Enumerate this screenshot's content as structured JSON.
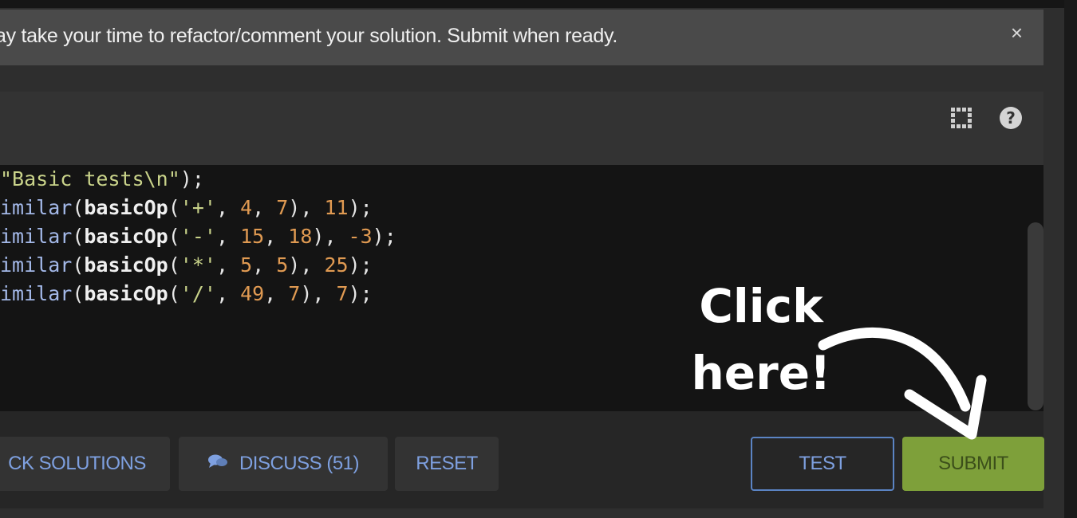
{
  "banner": {
    "text": "ay take your time to refactor/comment your solution. Submit when ready.",
    "close_glyph": "×"
  },
  "header_icons": {
    "expand": "expand-icon",
    "help_glyph": "?"
  },
  "code_lines": [
    [
      {
        "t": "\"Basic tests\\n\"",
        "c": "str"
      },
      {
        "t": ");",
        "c": "plain"
      }
    ],
    [
      {
        "t": "imilar",
        "c": "fn"
      },
      {
        "t": "(",
        "c": "plain"
      },
      {
        "t": "basicOp",
        "c": "bold"
      },
      {
        "t": "(",
        "c": "plain"
      },
      {
        "t": "'+'",
        "c": "str"
      },
      {
        "t": ", ",
        "c": "plain"
      },
      {
        "t": "4",
        "c": "num"
      },
      {
        "t": ", ",
        "c": "plain"
      },
      {
        "t": "7",
        "c": "num"
      },
      {
        "t": "), ",
        "c": "plain"
      },
      {
        "t": "11",
        "c": "num"
      },
      {
        "t": ");",
        "c": "plain"
      }
    ],
    [
      {
        "t": "imilar",
        "c": "fn"
      },
      {
        "t": "(",
        "c": "plain"
      },
      {
        "t": "basicOp",
        "c": "bold"
      },
      {
        "t": "(",
        "c": "plain"
      },
      {
        "t": "'-'",
        "c": "str"
      },
      {
        "t": ", ",
        "c": "plain"
      },
      {
        "t": "15",
        "c": "num"
      },
      {
        "t": ", ",
        "c": "plain"
      },
      {
        "t": "18",
        "c": "num"
      },
      {
        "t": "), ",
        "c": "plain"
      },
      {
        "t": "-3",
        "c": "num"
      },
      {
        "t": ");",
        "c": "plain"
      }
    ],
    [
      {
        "t": "imilar",
        "c": "fn"
      },
      {
        "t": "(",
        "c": "plain"
      },
      {
        "t": "basicOp",
        "c": "bold"
      },
      {
        "t": "(",
        "c": "plain"
      },
      {
        "t": "'*'",
        "c": "str"
      },
      {
        "t": ", ",
        "c": "plain"
      },
      {
        "t": "5",
        "c": "num"
      },
      {
        "t": ", ",
        "c": "plain"
      },
      {
        "t": "5",
        "c": "num"
      },
      {
        "t": "), ",
        "c": "plain"
      },
      {
        "t": "25",
        "c": "num"
      },
      {
        "t": ");",
        "c": "plain"
      }
    ],
    [
      {
        "t": "imilar",
        "c": "fn"
      },
      {
        "t": "(",
        "c": "plain"
      },
      {
        "t": "basicOp",
        "c": "bold"
      },
      {
        "t": "(",
        "c": "plain"
      },
      {
        "t": "'/'",
        "c": "str"
      },
      {
        "t": ", ",
        "c": "plain"
      },
      {
        "t": "49",
        "c": "num"
      },
      {
        "t": ", ",
        "c": "plain"
      },
      {
        "t": "7",
        "c": "num"
      },
      {
        "t": "), ",
        "c": "plain"
      },
      {
        "t": "7",
        "c": "num"
      },
      {
        "t": ");",
        "c": "plain"
      }
    ]
  ],
  "buttons": {
    "solutions": "CK SOLUTIONS",
    "discuss": "DISCUSS (51)",
    "reset": "RESET",
    "test": "TEST",
    "submit": "SUBMIT"
  },
  "annotation": {
    "line1": "Click",
    "line2": "here!"
  },
  "colors": {
    "submit": "#7ea03a",
    "link_blue": "#7ea0e0",
    "test_border": "#5b84c4"
  }
}
